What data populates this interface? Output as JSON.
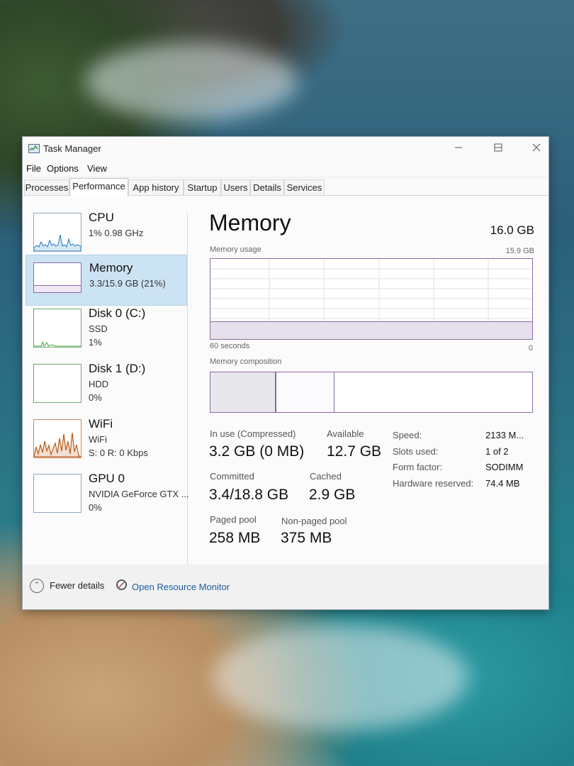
{
  "window": {
    "title": "Task Manager"
  },
  "menu": [
    "File",
    "Options",
    "View"
  ],
  "tabs": [
    "Processes",
    "Performance",
    "App history",
    "Startup",
    "Users",
    "Details",
    "Services"
  ],
  "active_tab": "Performance",
  "sidebar": {
    "items": [
      {
        "name": "CPU",
        "line1": "1%  0.98 GHz",
        "line2": ""
      },
      {
        "name": "Memory",
        "line1": "3.3/15.9 GB (21%)",
        "line2": ""
      },
      {
        "name": "Disk 0 (C:)",
        "line1": "SSD",
        "line2": "1%"
      },
      {
        "name": "Disk 1 (D:)",
        "line1": "HDD",
        "line2": "0%"
      },
      {
        "name": "WiFi",
        "line1": "WiFi",
        "line2": "S: 0  R: 0 Kbps"
      },
      {
        "name": "GPU 0",
        "line1": "NVIDIA GeForce GTX ...",
        "line2": "0%"
      }
    ],
    "selected": "Memory"
  },
  "main": {
    "title": "Memory",
    "total": "16.0 GB",
    "usage_label": "Memory usage",
    "usage_max": "15.9 GB",
    "time_label": "60 seconds",
    "time_end": "0",
    "usage_fraction": 0.21,
    "composition_label": "Memory composition",
    "composition": {
      "in_use_fraction": 0.2,
      "modified_fraction": 0.005,
      "standby_fraction": 0.175
    },
    "stats": {
      "in_use_label": "In use (Compressed)",
      "in_use_value": "3.2 GB (0 MB)",
      "available_label": "Available",
      "available_value": "12.7 GB",
      "committed_label": "Committed",
      "committed_value": "3.4/18.8 GB",
      "cached_label": "Cached",
      "cached_value": "2.9 GB",
      "paged_label": "Paged pool",
      "paged_value": "258 MB",
      "nonpaged_label": "Non-paged pool",
      "nonpaged_value": "375 MB"
    },
    "details": {
      "speed_label": "Speed:",
      "speed_value": "2133 M...",
      "slots_label": "Slots used:",
      "slots_value": "1 of 2",
      "form_label": "Form factor:",
      "form_value": "SODIMM",
      "reserved_label": "Hardware reserved:",
      "reserved_value": "74.4 MB"
    }
  },
  "footer": {
    "fewer_details": "Fewer details",
    "resource_monitor": "Open Resource Monitor"
  },
  "colors": {
    "memory_accent": "#8c6aa8",
    "selected_bg": "#cce3f3",
    "link": "#1e5aa8",
    "cpu_line": "#1f76c2",
    "disk_line": "#4ca64c",
    "wifi_line": "#b85d1f"
  }
}
